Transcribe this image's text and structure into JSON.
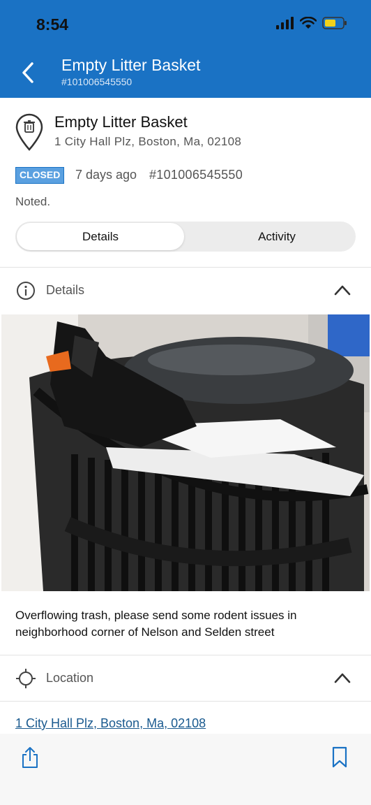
{
  "status_bar": {
    "time": "8:54"
  },
  "nav": {
    "title": "Empty Litter Basket",
    "subtitle": "#101006545550"
  },
  "summary": {
    "title": "Empty Litter Basket",
    "address": "1 City Hall Plz, Boston, Ma, 02108",
    "status_badge": "CLOSED",
    "age": "7 days ago",
    "case_id": "#101006545550",
    "note": "Noted.",
    "tabs": [
      {
        "label": "Details",
        "selected": true
      },
      {
        "label": "Activity",
        "selected": false
      }
    ]
  },
  "details_section": {
    "label": "Details",
    "icon": "info-icon",
    "description": "Overflowing trash, please send some rodent issues in neighborhood corner of Nelson and Selden street"
  },
  "location_section": {
    "label": "Location",
    "icon": "crosshair-icon",
    "address_link": "1 City Hall Plz, Boston, Ma, 02108"
  },
  "toolbar": {
    "share_icon": "share-icon",
    "bookmark_icon": "bookmark-icon"
  },
  "colors": {
    "header": "#1a72c4",
    "badge": "#5aa0e0",
    "link": "#1a5a8f"
  }
}
